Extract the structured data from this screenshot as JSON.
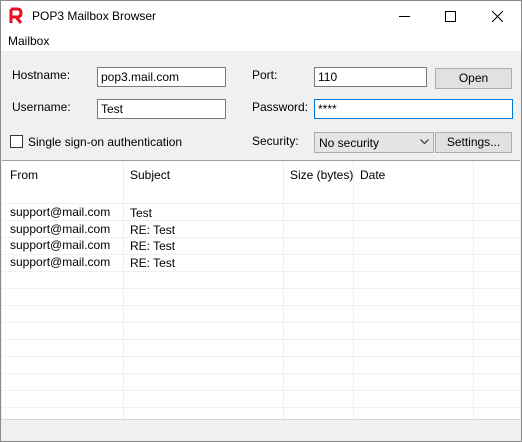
{
  "window": {
    "title": "POP3 Mailbox Browser"
  },
  "menu": {
    "items": [
      "Mailbox"
    ]
  },
  "form": {
    "hostname_label": "Hostname:",
    "hostname_value": "pop3.mail.com",
    "port_label": "Port:",
    "port_value": "110",
    "open_label": "Open",
    "username_label": "Username:",
    "username_value": "Test",
    "password_label": "Password:",
    "password_value": "****",
    "sso_label": "Single sign-on authentication",
    "sso_checked": false,
    "security_label": "Security:",
    "security_value": "No security",
    "settings_label": "Settings..."
  },
  "list": {
    "columns": [
      "From",
      "Subject",
      "Size (bytes)",
      "Date"
    ],
    "rows": [
      {
        "from": "support@mail.com",
        "subject": "Test",
        "size": "",
        "date": ""
      },
      {
        "from": "support@mail.com",
        "subject": "RE: Test",
        "size": "",
        "date": ""
      },
      {
        "from": "support@mail.com",
        "subject": "RE: Test",
        "size": "",
        "date": ""
      },
      {
        "from": "support@mail.com",
        "subject": "RE: Test",
        "size": "",
        "date": ""
      }
    ]
  },
  "colors": {
    "accent": "#0078d7",
    "logo": "#e81123"
  }
}
